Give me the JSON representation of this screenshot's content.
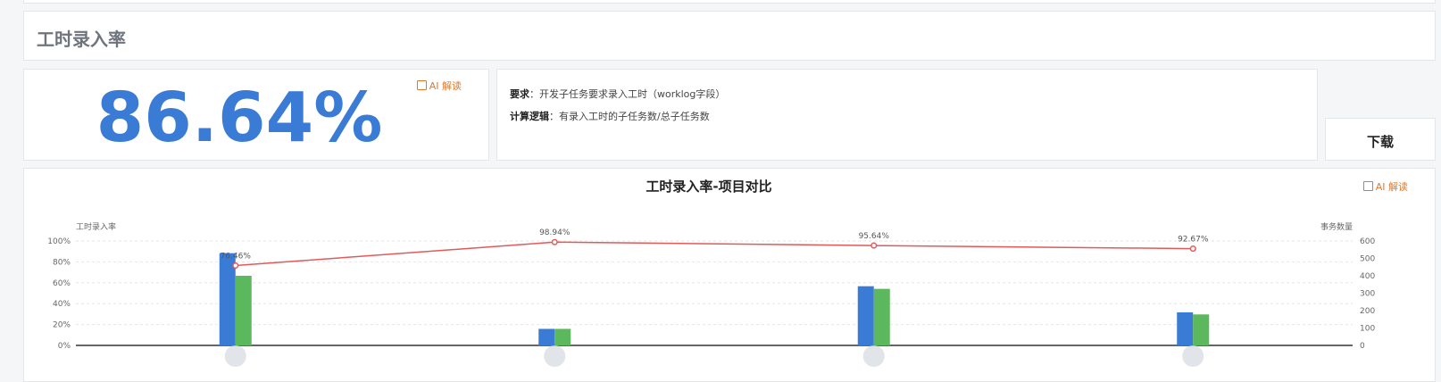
{
  "section": {
    "title": "工时录入率"
  },
  "metric": {
    "value": "86.64%",
    "ai_label": "AI 解读"
  },
  "description": {
    "req_label": "要求",
    "req_text": "：开发子任务要求录入工时（worklog字段）",
    "calc_label": "计算逻辑",
    "calc_text": "：有录入工时的子任务数/总子任务数"
  },
  "download": {
    "label": "下载"
  },
  "chart_ai_label": "AI 解读",
  "colors": {
    "accent": "#3a7bd5",
    "bar1": "#3a7bd5",
    "bar2": "#5cb85c",
    "line": "#e05a5a",
    "ai": "#e0792b"
  },
  "chart_data": {
    "type": "bar",
    "title": "工时录入率-项目对比",
    "categories": [
      "",
      "",
      "",
      ""
    ],
    "ylabel_left": "工时录入率",
    "ylabel_right": "事务数量",
    "yticks_left": [
      "0%",
      "20%",
      "40%",
      "60%",
      "80%",
      "100%"
    ],
    "yticks_right": [
      "0",
      "100",
      "200",
      "300",
      "400",
      "500",
      "600"
    ],
    "ylim_left": [
      0,
      100
    ],
    "ylim_right": [
      0,
      600
    ],
    "grid": true,
    "bar_series": [
      {
        "values": [
          530,
          95,
          340,
          190
        ]
      },
      {
        "values": [
          400,
          95,
          325,
          178
        ]
      }
    ],
    "line_series": {
      "values": [
        76.46,
        98.94,
        95.64,
        92.67
      ],
      "labels": [
        "76.46%",
        "98.94%",
        "95.64%",
        "92.67%"
      ]
    }
  }
}
